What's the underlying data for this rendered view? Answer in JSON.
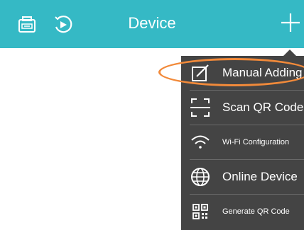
{
  "header": {
    "title": "Device",
    "left_icons": [
      "device-list-icon",
      "playback-icon"
    ],
    "right_icon": "plus-icon",
    "background": "#35B9C5"
  },
  "menu": {
    "background": "#444444",
    "items": [
      {
        "label": "Manual Adding",
        "icon": "edit-icon"
      },
      {
        "label": "Scan QR Code",
        "icon": "scan-icon"
      },
      {
        "label": "Wi-Fi Configuration",
        "icon": "wifi-icon"
      },
      {
        "label": "Online Device",
        "icon": "globe-icon"
      },
      {
        "label": "Generate QR Code",
        "icon": "qr-code-icon"
      }
    ]
  },
  "highlight_color": "#F28A3A"
}
